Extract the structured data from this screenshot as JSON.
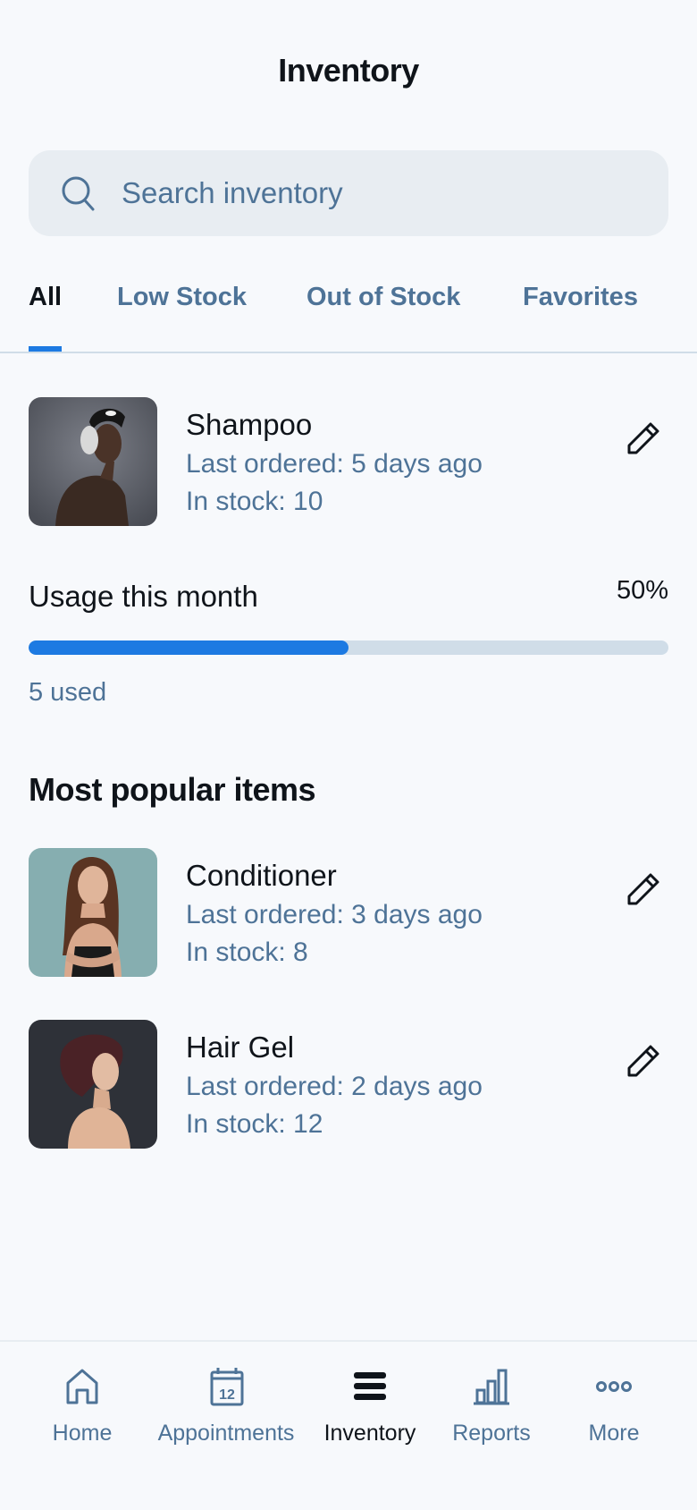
{
  "header": {
    "title": "Inventory"
  },
  "search": {
    "placeholder": "Search inventory",
    "value": ""
  },
  "tabs": [
    {
      "label": "All",
      "active": true
    },
    {
      "label": "Low Stock",
      "active": false
    },
    {
      "label": "Out of Stock",
      "active": false
    },
    {
      "label": "Favorites",
      "active": false
    }
  ],
  "featured_item": {
    "name": "Shampoo",
    "last_ordered": "Last ordered: 5 days ago",
    "in_stock": "In stock: 10",
    "image": "portrait-shampoo"
  },
  "usage": {
    "label": "Usage this month",
    "percent_text": "50%",
    "percent": 50,
    "used_text": "5 used"
  },
  "popular": {
    "title": "Most popular items",
    "items": [
      {
        "name": "Conditioner",
        "last_ordered": "Last ordered: 3 days ago",
        "in_stock": "In stock: 8",
        "image": "portrait-conditioner"
      },
      {
        "name": "Hair Gel",
        "last_ordered": "Last ordered: 2 days ago",
        "in_stock": "In stock: 12",
        "image": "portrait-hair-gel"
      }
    ]
  },
  "bottom_nav": [
    {
      "label": "Home",
      "icon": "home-icon",
      "active": false
    },
    {
      "label": "Appointments",
      "icon": "calendar-icon",
      "icon_text": "12",
      "active": false
    },
    {
      "label": "Inventory",
      "icon": "list-icon",
      "active": true
    },
    {
      "label": "Reports",
      "icon": "bar-chart-icon",
      "active": false
    },
    {
      "label": "More",
      "icon": "more-icon",
      "active": false
    }
  ],
  "colors": {
    "background": "#f7f9fc",
    "accent": "#1d7ae2",
    "muted_text": "#4e7397",
    "primary_text": "#0f141a",
    "search_bg": "#e8edf2",
    "track": "#d0dde8"
  }
}
